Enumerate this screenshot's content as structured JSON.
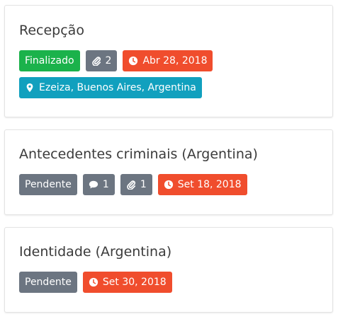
{
  "cards": [
    {
      "title": "Recepção",
      "status": "Finalizado",
      "attachments": "2",
      "date": "Abr 28, 2018",
      "location": "Ezeiza, Buenos Aires, Argentina"
    },
    {
      "title": "Antecedentes criminais (Argentina)",
      "status": "Pendente",
      "comments": "1",
      "attachments": "1",
      "date": "Set 18, 2018"
    },
    {
      "title": "Identidade (Argentina)",
      "status": "Pendente",
      "date": "Set 30, 2018"
    }
  ],
  "colors": {
    "finalizado": "#1bb24b",
    "pendente": "#6c7581",
    "count": "#6c7581",
    "date": "#f04d2d",
    "location": "#11a0be"
  },
  "icons": {
    "attachment": "paperclip-icon",
    "comment": "comment-icon",
    "date": "clock-icon",
    "location": "map-pin-icon"
  }
}
